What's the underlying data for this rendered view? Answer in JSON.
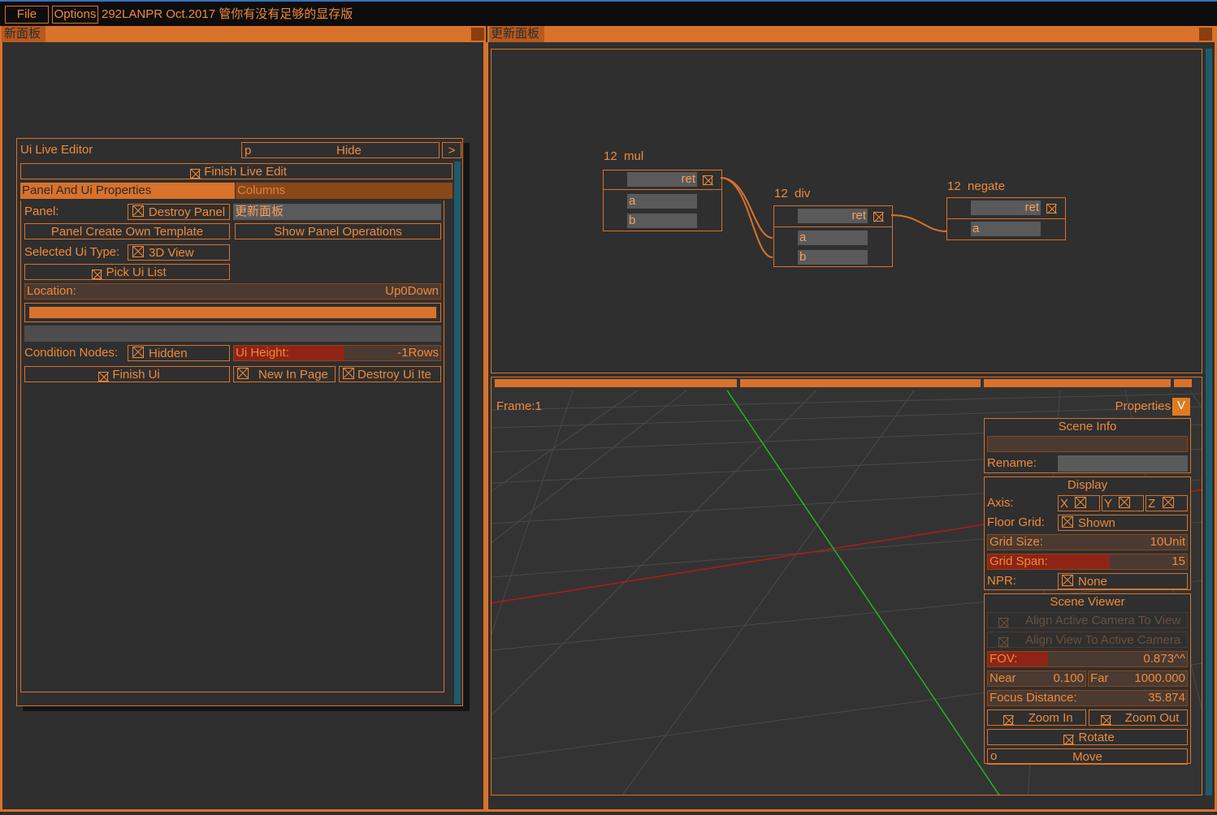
{
  "menubar": {
    "file": "File",
    "options": "Options",
    "title": "292LANPR Oct.2017 管你有没有足够的显存版"
  },
  "left_panel": {
    "tab": "新面板"
  },
  "right_panel": {
    "tab": "更新面板"
  },
  "editor": {
    "title": "Ui Live Editor",
    "search_value": "p",
    "hide": "Hide",
    "expand": ">",
    "finish_live_edit": "Finish Live Edit",
    "tabs": [
      "Panel And Ui Properties",
      "Columns"
    ],
    "panel_label": "Panel:",
    "destroy_panel": "Destroy Panel",
    "panel_name": "更新面板",
    "create_template": "Panel Create Own Template",
    "show_operations": "Show Panel Operations",
    "selected_type_label": "Selected Ui Type:",
    "selected_type_value": "3D View",
    "pick_ui_list": "Pick Ui List",
    "location_label": "Location:",
    "location_value": "Up0Down",
    "condition_label": "Condition Nodes:",
    "condition_value": "Hidden",
    "ui_height_label": "Ui Height:",
    "ui_height_value": "-1Rows",
    "finish_ui": "Finish Ui",
    "new_in_page": "New In Page",
    "destroy_ui_item": "Destroy Ui Ite"
  },
  "nodes": {
    "mul": {
      "count": "12",
      "name": "mul",
      "out": "ret",
      "inputs": [
        "a",
        "b"
      ]
    },
    "div": {
      "count": "12",
      "name": "div",
      "out": "ret",
      "inputs": [
        "a",
        "b"
      ]
    },
    "negate": {
      "count": "12",
      "name": "negate",
      "out": "ret",
      "inputs": [
        "a"
      ]
    }
  },
  "viewport": {
    "frame": "Frame:1",
    "properties": "Properties",
    "properties_toggle": "V",
    "scene_info": {
      "title": "Scene Info",
      "rename_label": "Rename:"
    },
    "display": {
      "title": "Display",
      "axis_label": "Axis:",
      "axes": [
        "X",
        "Y",
        "Z"
      ],
      "floor_grid_label": "Floor Grid:",
      "floor_grid_value": "Shown",
      "grid_size_label": "Grid Size:",
      "grid_size_value": "10Unit",
      "grid_span_label": "Grid Span:",
      "grid_span_value": "15",
      "npr_label": "NPR:",
      "npr_value": "None"
    },
    "scene_viewer": {
      "title": "Scene Viewer",
      "align_camera_to_view": "Align Active Camera To View",
      "align_view_to_camera": "Align View To Active Camera",
      "fov_label": "FOV:",
      "fov_value": "0.873^^",
      "fov_fraction": 0.3,
      "near_label": "Near",
      "near_value": "0.100",
      "far_label": "Far",
      "far_value": "1000.000",
      "focus_label": "Focus Distance:",
      "focus_value": "35.874",
      "zoom_in": "Zoom In",
      "zoom_out": "Zoom Out",
      "rotate": "Rotate",
      "move_key": "o",
      "move": "Move"
    }
  }
}
